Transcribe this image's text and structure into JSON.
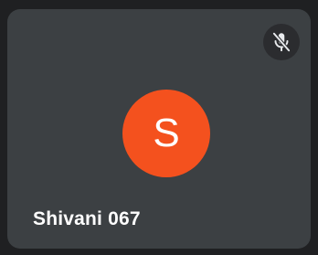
{
  "participant": {
    "name": "Shivani 067",
    "avatar_initial": "S",
    "avatar_color": "#f4511e",
    "mic_status_icon": "mic-off-icon",
    "muted": true
  },
  "theme": {
    "tile_background": "#3c4043",
    "page_background": "#1f2022",
    "name_color": "#ffffff"
  }
}
